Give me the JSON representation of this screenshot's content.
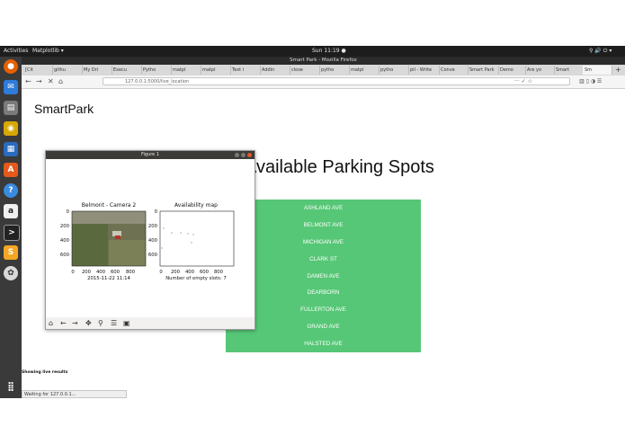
{
  "system": {
    "activities": "Activities",
    "app_menu": "Matplotlib ▾",
    "clock": "Sun 11:19 ●",
    "tray": "⚲ 🔊 ⏻ ▾"
  },
  "browser": {
    "window_title": "Smart Park - Mozilla Firefox",
    "tabs": [
      "[Cit",
      "githu",
      "My Dri",
      "Execu",
      "Pytho",
      "matpl",
      "matpl",
      "Text i",
      "Addin",
      "close",
      "pytho",
      "matpl",
      "pytho",
      "pil - Write",
      "Conve",
      "Smart Park",
      "Demo",
      "Are yo",
      "Smart",
      "Sm"
    ],
    "url": "127.0.0.1:5000/live_location",
    "status": "Waiting for 127.0.0.1..."
  },
  "page": {
    "brand": "SmartPark",
    "heading": "Available Parking Spots",
    "spots": [
      "ASHLAND AVE",
      "BELMONT AVE",
      "MICHIGAN AVE",
      "CLARK ST",
      "DAMEN AVE",
      "DEARBORN",
      "FULLERTON AVE",
      "GRAND AVE",
      "HALSTED AVE"
    ],
    "live_label": "Showing live results"
  },
  "figure": {
    "window_title": "Figure 1",
    "left_title": "Belmont - Camera 2",
    "left_caption": "2015-11-22 11:14",
    "left_yticks": [
      "0",
      "200",
      "400",
      "600"
    ],
    "left_xticks": [
      "0",
      "200",
      "400",
      "600",
      "800"
    ],
    "right_title": "Availability map",
    "right_caption": "Number of empty slots: 7",
    "right_yticks": [
      "0",
      "200",
      "400",
      "600"
    ],
    "right_xticks": [
      "0",
      "200",
      "400",
      "600",
      "800"
    ]
  },
  "colors": {
    "accent_green": "#56c776",
    "dock_bg": "#3a3a3a",
    "topbar_bg": "#1d1d1d"
  }
}
